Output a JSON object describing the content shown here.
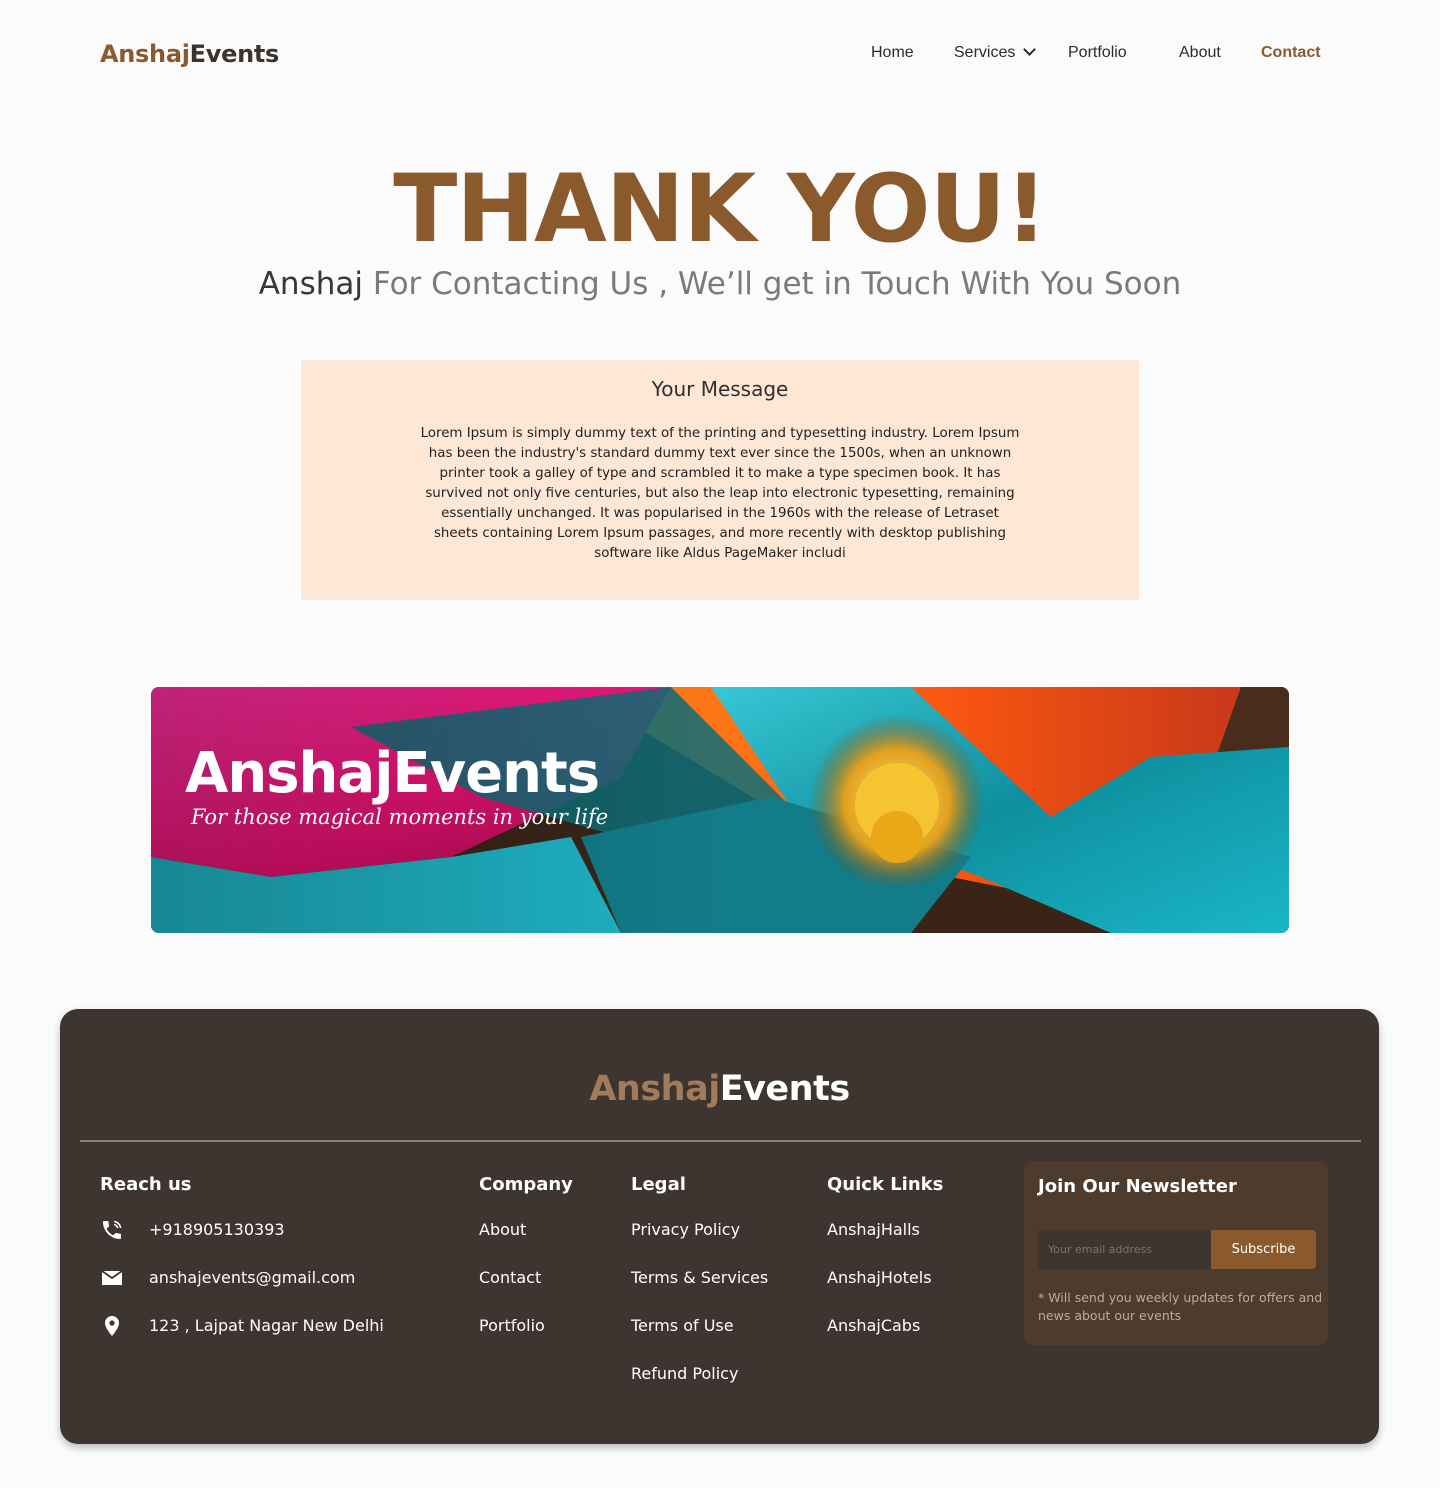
{
  "header": {
    "logo_part1": "Anshaj",
    "logo_part2": "Events",
    "nav": [
      {
        "label": "Home"
      },
      {
        "label": "Services"
      },
      {
        "label": "Portfolio"
      },
      {
        "label": "About"
      },
      {
        "label": "Contact"
      }
    ]
  },
  "hero": {
    "title": "THANK YOU!",
    "name": "Anshaj",
    "subtitle": " For Contacting Us , We’ll get in Touch With You Soon"
  },
  "message": {
    "title": "Your Message",
    "body": "Lorem Ipsum is simply dummy text of the printing and typesetting industry. Lorem Ipsum has been the industry's standard dummy text ever since the 1500s, when an unknown printer took a galley of type and scrambled it to make a type specimen book. It has survived not only five centuries, but also the leap into electronic typesetting, remaining essentially unchanged. It was popularised in the 1960s with the release of Letraset sheets containing Lorem Ipsum passages, and more recently with desktop publishing software like Aldus PageMaker includi"
  },
  "banner": {
    "title": "AnshajEvents",
    "tagline": "For those magical moments in your life"
  },
  "footer": {
    "logo_part1": "Anshaj",
    "logo_part2": "Events",
    "reach": {
      "heading": "Reach us",
      "phone": "+918905130393",
      "email": "anshajevents@gmail.com",
      "address": "123 , Lajpat Nagar New Delhi"
    },
    "company": {
      "heading": "Company",
      "links": [
        "About",
        "Contact",
        "Portfolio"
      ]
    },
    "legal": {
      "heading": "Legal",
      "links": [
        "Privacy Policy",
        "Terms & Services",
        "Terms of Use",
        "Refund Policy"
      ]
    },
    "quick": {
      "heading": "Quick Links",
      "links": [
        "AnshajHalls",
        "AnshajHotels",
        "AnshajCabs"
      ]
    },
    "newsletter": {
      "heading": "Join Our Newsletter",
      "placeholder": "Your email address",
      "button": "Subscribe",
      "note": "*  Will send you weekly updates for offers and news about our events"
    }
  },
  "colors": {
    "brand": "#8a5a2c",
    "footer_bg": "#3e3530",
    "message_bg": "#ffe7d6"
  }
}
